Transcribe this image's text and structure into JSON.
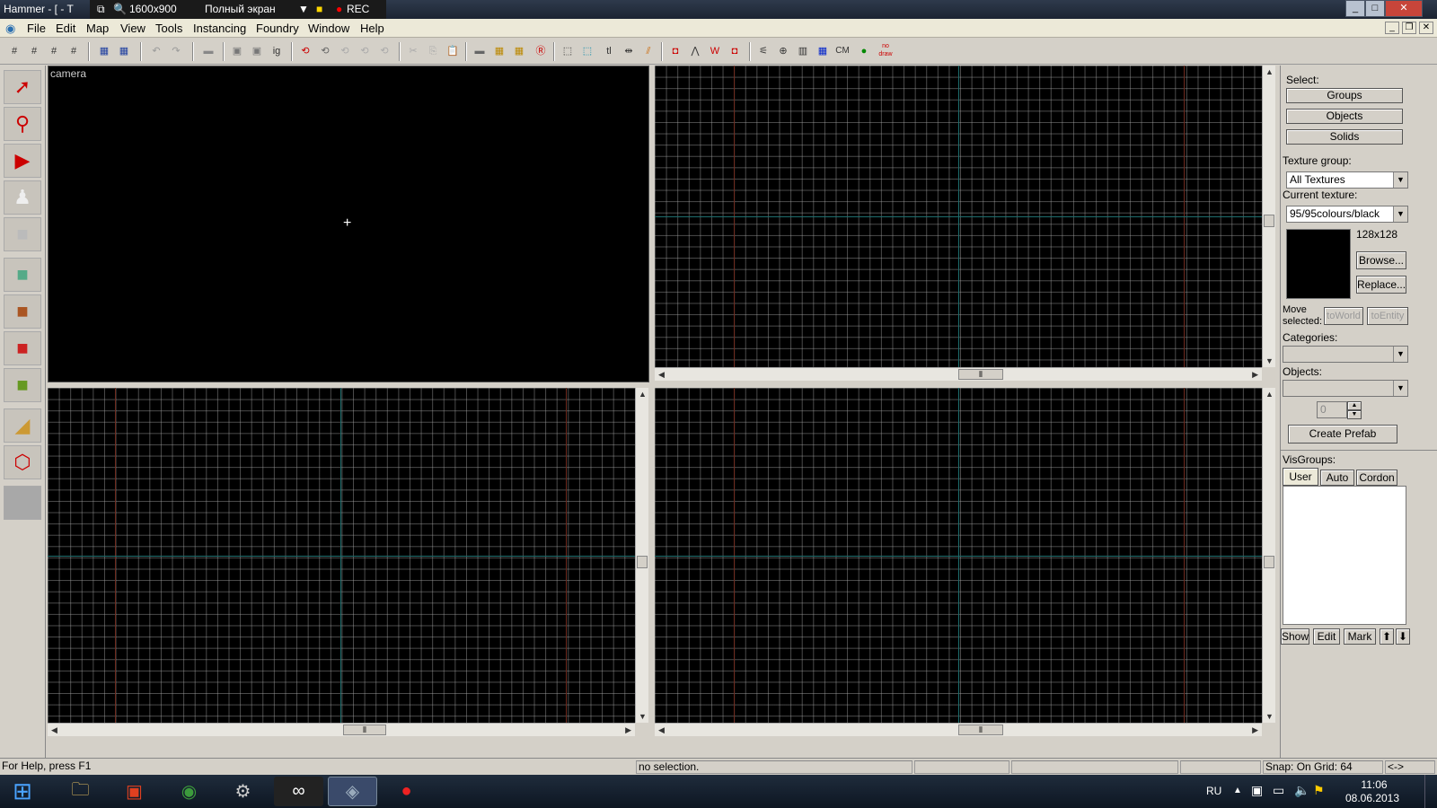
{
  "titlebar": {
    "app_title": "Hammer - [ - T",
    "resolution": "1600x900",
    "mode": "Полный экран",
    "rec": "REC"
  },
  "menu": [
    "File",
    "Edit",
    "Map",
    "View",
    "Tools",
    "Instancing",
    "Foundry",
    "Window",
    "Help"
  ],
  "toolbar": {
    "ig_label": "ig",
    "tl_label": "tl",
    "cm_label": "CM",
    "nodraw_label": "no draw"
  },
  "viewports": {
    "camera_label": "camera"
  },
  "right_panel": {
    "select_label": "Select:",
    "groups": "Groups",
    "objects_btn": "Objects",
    "solids": "Solids",
    "texture_group_label": "Texture group:",
    "texture_group_value": "All Textures",
    "current_texture_label": "Current texture:",
    "current_texture_value": "95/95colours/black",
    "texture_size": "128x128",
    "browse": "Browse...",
    "replace": "Replace...",
    "move_selected_label": "Move selected:",
    "to_world": "toWorld",
    "to_entity": "toEntity",
    "categories_label": "Categories:",
    "objects_label": "Objects:",
    "count_value": "0",
    "create_prefab": "Create Prefab",
    "visgroups_label": "VisGroups:",
    "tab_user": "User",
    "tab_auto": "Auto",
    "tab_cordon": "Cordon",
    "show": "Show",
    "edit": "Edit",
    "mark": "Mark"
  },
  "statusbar": {
    "help": "For Help, press F1",
    "selection": "no selection.",
    "snap": "Snap: On Grid: 64",
    "arrows": "<->"
  },
  "taskbar": {
    "lang": "RU",
    "time": "11:06",
    "date": "08.06.2013"
  },
  "colors": {
    "grid_line": "#5a5a5a",
    "axis_teal": "#1e6e6e",
    "axis_red": "#6e2a1e",
    "viewport_bg": "#000000"
  }
}
